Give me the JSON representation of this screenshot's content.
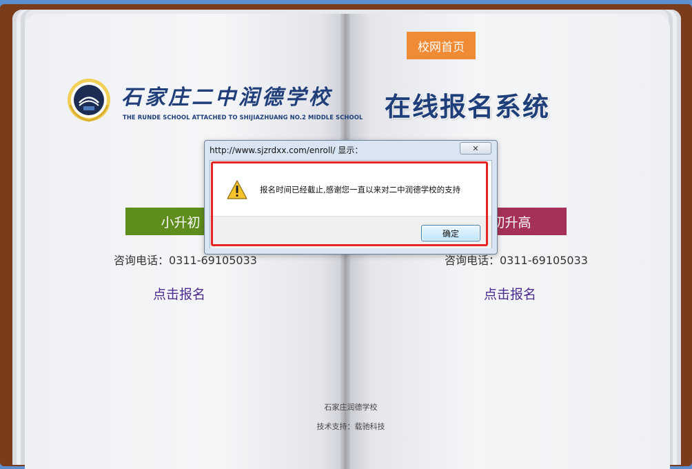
{
  "nav": {
    "home_label": "校网首页"
  },
  "logo": {
    "name": "石家庄二中润德学校",
    "subtitle": "THE RUNDE SCHOOL ATTACHED TO SHIJIAZHUANG NO.2 MIDDLE SCHOOL"
  },
  "page_title": "在线报名系统",
  "sections": [
    {
      "title": "小升初",
      "phone": "咨询电话：0311-69105033",
      "link": "点击报名",
      "color": "#5e8c1d"
    },
    {
      "title": "初升高",
      "phone": "咨询电话：0311-69105033",
      "link": "点击报名",
      "color": "#a53158"
    }
  ],
  "footer": {
    "name": "石家庄润德学校",
    "support": "技术支持：载驰科技"
  },
  "dialog": {
    "title": "http://www.sjzrdxx.com/enroll/ 显示：",
    "message": "报名时间已经截止,感谢您一直以来对二中润德学校的支持",
    "ok_label": "确定",
    "icon": "warning-icon",
    "highlight_color": "#e52320"
  }
}
